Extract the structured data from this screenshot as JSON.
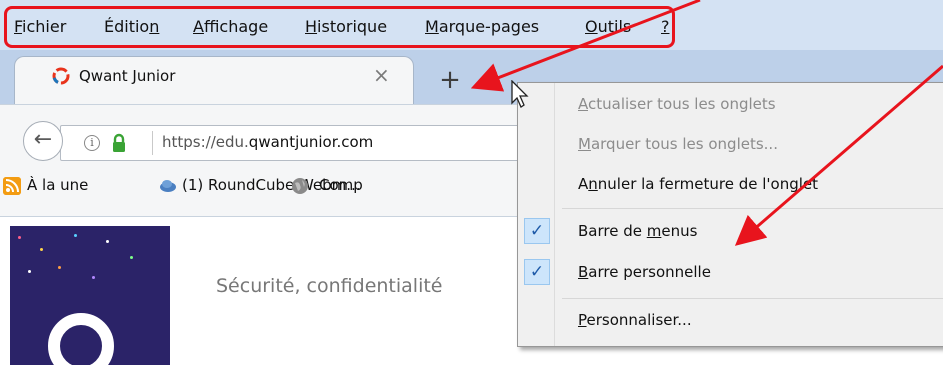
{
  "menubar": {
    "items": [
      {
        "label": "Fichier",
        "underline": "F"
      },
      {
        "label": "Édition",
        "underline": "n"
      },
      {
        "label": "Affichage",
        "underline": "A"
      },
      {
        "label": "Historique",
        "underline": "H"
      },
      {
        "label": "Marque-pages",
        "underline": "M"
      },
      {
        "label": "Outils",
        "underline": "O"
      },
      {
        "label": "?",
        "underline": "?"
      }
    ]
  },
  "tab": {
    "title": "Qwant Junior",
    "close_glyph": "×",
    "new_tab_glyph": "+"
  },
  "navbar": {
    "back_glyph": "←",
    "info_glyph": "i",
    "url_prefix": "https://edu.",
    "url_domain": "qwantjunior.com"
  },
  "bookmarks": {
    "items": [
      {
        "label": "À la une",
        "icon": "rss-icon"
      },
      {
        "label": "(1) RoundCube Webm...",
        "icon": "cloud-icon"
      },
      {
        "label": "Comp",
        "icon": "globe-icon"
      }
    ],
    "overflow_text": "pe"
  },
  "page": {
    "text": "Sécurité, confidentialité",
    "link_fragment": "i"
  },
  "context_menu": {
    "items": [
      {
        "label": "Actualiser tous les onglets",
        "underline": "A",
        "disabled": true,
        "checked": false
      },
      {
        "label": "Marquer tous les onglets...",
        "underline": "M",
        "disabled": true,
        "checked": false
      },
      {
        "label": "Annuler la fermeture de l'onglet",
        "underline": "n",
        "disabled": false,
        "checked": false
      },
      {
        "label": "Barre de menus",
        "underline": "m",
        "disabled": false,
        "checked": true
      },
      {
        "label": "Barre personnelle",
        "underline": "B",
        "disabled": false,
        "checked": true
      },
      {
        "label": "Personnaliser...",
        "underline": "P",
        "disabled": false,
        "checked": false
      }
    ],
    "check_glyph": "✓"
  },
  "colors": {
    "annotation_red": "#e8141d",
    "menubar_bg": "#d4e2f3",
    "tabstrip_bg": "#bdd0e9"
  }
}
